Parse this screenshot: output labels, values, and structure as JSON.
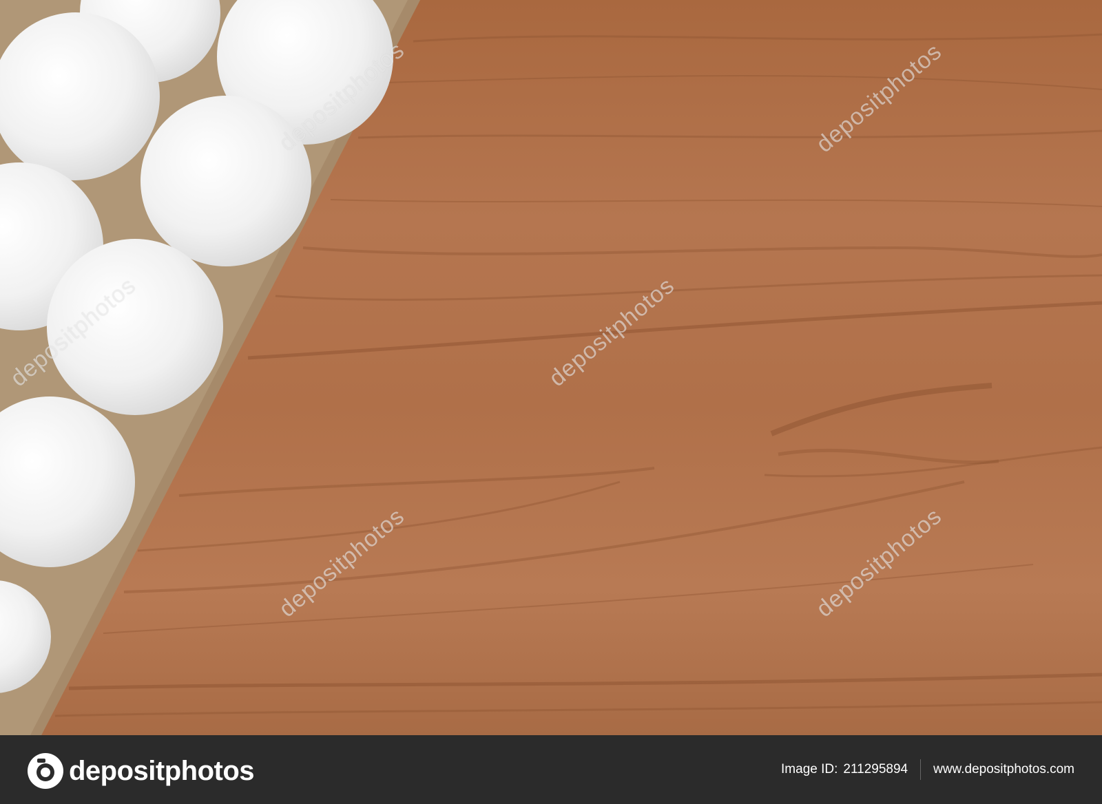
{
  "watermark": {
    "text": "depositphotos"
  },
  "footer": {
    "brand": "depositphotos",
    "image_id_label": "Image ID:",
    "image_id": "211295894",
    "site": "www.depositphotos.com",
    "background": "#2b2b2b"
  },
  "colors": {
    "wood": "#a86a42",
    "wood_dark": "#8f5533",
    "carton": "#b39a7c",
    "egg": "#f2f2f2"
  }
}
